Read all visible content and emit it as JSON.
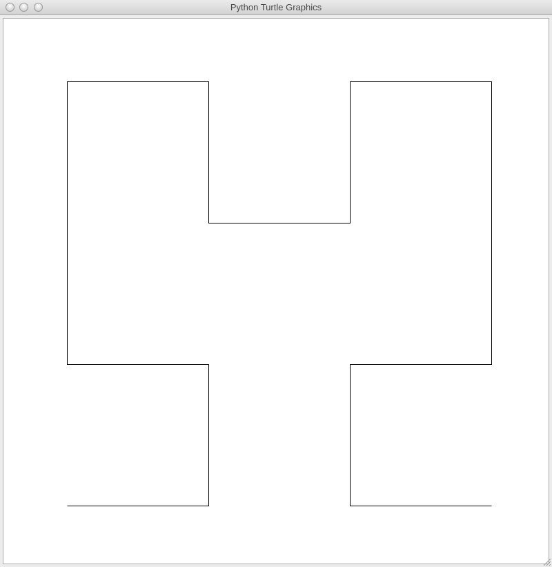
{
  "window": {
    "title": "Python Turtle Graphics"
  },
  "icons": {
    "close": "close-button",
    "minimize": "minimize-button",
    "zoom": "zoom-button",
    "resize": "resize-grip-icon"
  },
  "drawing": {
    "stroke_color": "#000000",
    "background_color": "#ffffff"
  }
}
